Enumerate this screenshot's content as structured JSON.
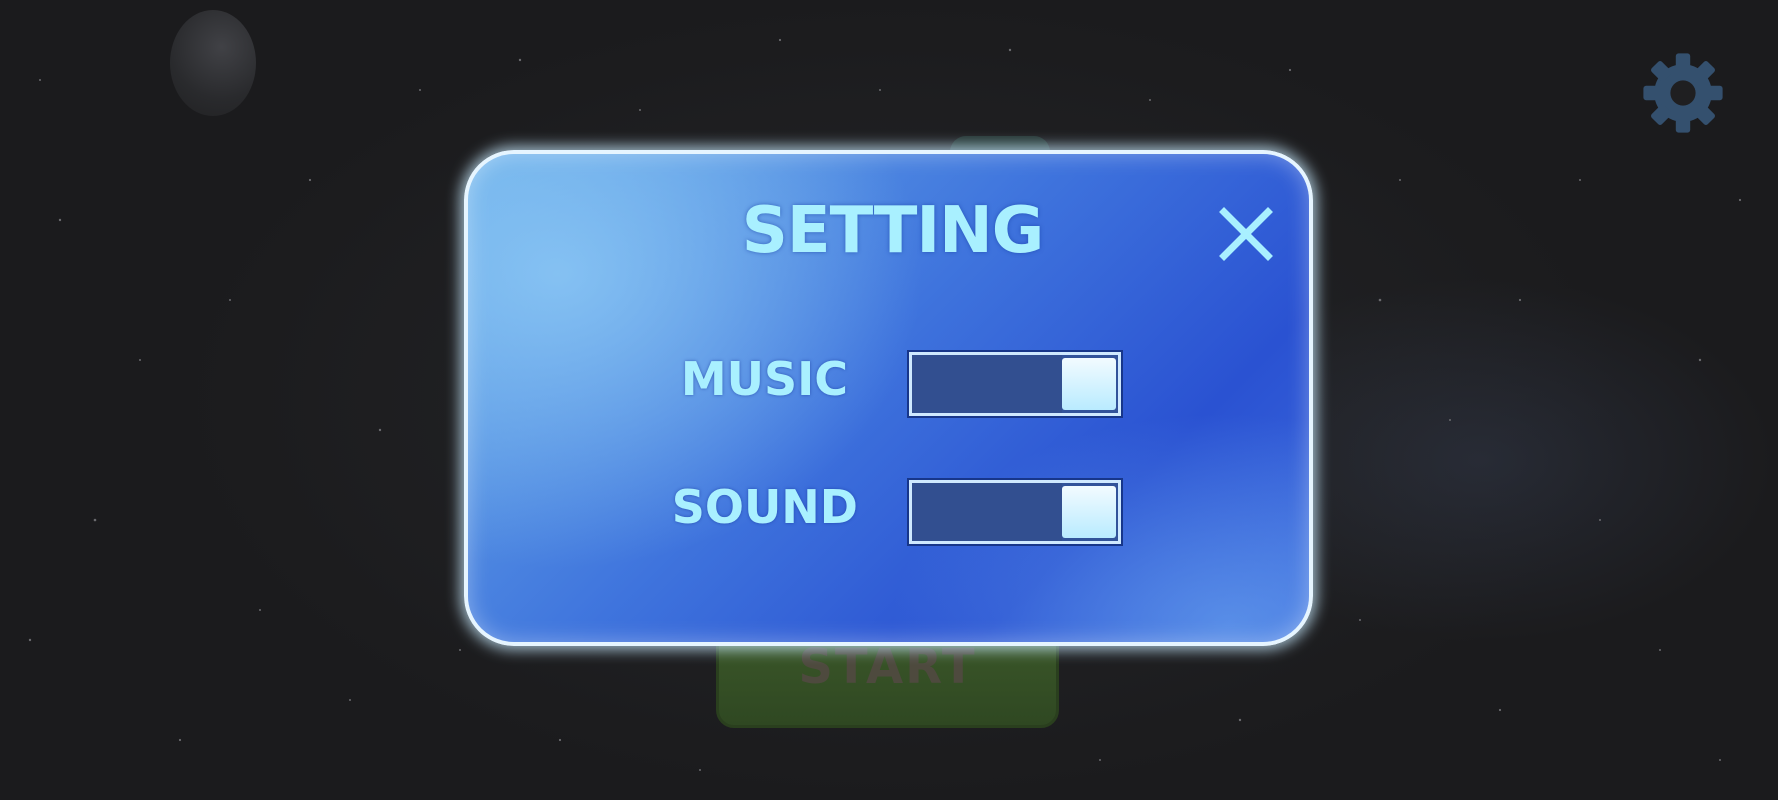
{
  "background": {
    "color": "#1f1f21"
  },
  "settings_button": {
    "icon": "gear-icon",
    "color": "#34506e"
  },
  "start_button": {
    "label": "START"
  },
  "dialog": {
    "title": "SETTING",
    "close_icon": "close-icon",
    "options": [
      {
        "label": "MUSIC",
        "enabled": true,
        "level": 1.0
      },
      {
        "label": "SOUND",
        "enabled": true,
        "level": 1.0
      }
    ],
    "accent_color": "#a9f0ff"
  }
}
